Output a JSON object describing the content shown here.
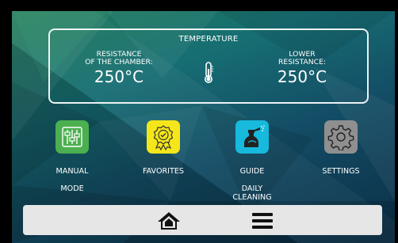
{
  "temperature": {
    "title": "TEMPERATURE",
    "chamber_label_line1": "RESISTANCE",
    "chamber_label_line2": "OF THE CHAMBER:",
    "chamber_value": "250°C",
    "lower_label_line1": "LOWER",
    "lower_label_line2": "RESISTANCE:",
    "lower_value": "250°C",
    "icon": "thermometer-icon"
  },
  "tiles": [
    {
      "label_line1": "MANUAL",
      "label_line2": "MODE",
      "color": "#4caf50",
      "icon": "sliders-icon"
    },
    {
      "label_line1": "FAVORITES",
      "label_line2": "",
      "color": "#f4e61a",
      "icon": "award-badge-icon"
    },
    {
      "label_line1": "GUIDE",
      "label_line2": "DAILY CLEANING",
      "color": "#17b9dd",
      "icon": "spray-bottle-icon"
    },
    {
      "label_line1": "SETTINGS",
      "label_line2": "",
      "color": "#8f8f8f",
      "icon": "gear-icon"
    }
  ],
  "bottom_bar": {
    "icons": [
      "home-icon",
      "menu-icon"
    ],
    "background": "#e6e6e6"
  }
}
